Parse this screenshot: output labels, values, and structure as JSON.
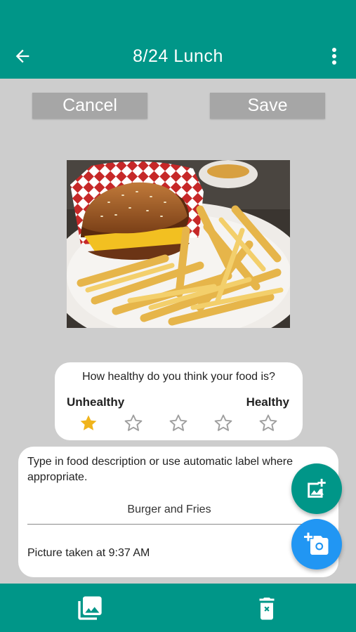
{
  "header": {
    "title": "8/24 Lunch",
    "back_icon": "arrow-left-icon",
    "menu_icon": "more-vert-icon"
  },
  "actions": {
    "cancel_label": "Cancel",
    "save_label": "Save"
  },
  "rating": {
    "question": "How healthy do you think your food is?",
    "min_label": "Unhealthy",
    "max_label": "Healthy",
    "value": 1,
    "max": 5
  },
  "description": {
    "hint": "Type in food description or use automatic label where appropriate.",
    "value": "Burger and Fries",
    "timestamp": "Picture taken at 9:37 AM"
  },
  "fabs": {
    "gallery_icon": "add-photo-icon",
    "camera_icon": "add-camera-icon"
  },
  "bottom_bar": {
    "gallery_icon": "photo-library-icon",
    "delete_icon": "delete-icon"
  },
  "colors": {
    "primary": "#009688",
    "accent_blue": "#2196f3",
    "star_filled": "#f0b41c",
    "star_empty": "#9e9e9e",
    "background": "#cdcdcd",
    "button_gray": "#a6a6a6"
  }
}
